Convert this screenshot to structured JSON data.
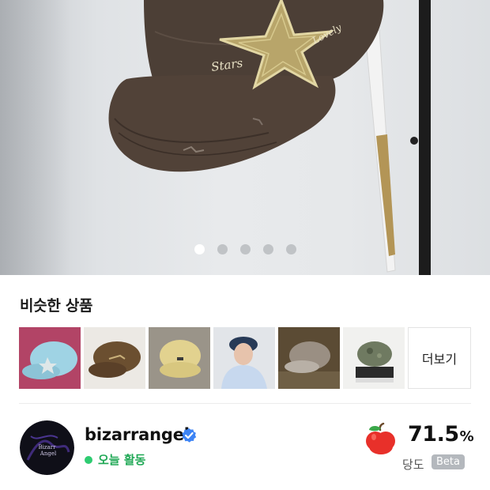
{
  "hero": {
    "image_name": "product-photo-brown-cap-star-patch",
    "cap_text_left": "Stars",
    "cap_text_right": "Lovely",
    "carousel": {
      "total": 5,
      "active": 0
    }
  },
  "similar": {
    "title": "비슷한 상품",
    "more_label": "더보기",
    "items": [
      {
        "name": "light-blue-cap-star-patch"
      },
      {
        "name": "brown-cap-embroidered"
      },
      {
        "name": "yellow-cap-small-logo"
      },
      {
        "name": "navy-cap-worn-by-model"
      },
      {
        "name": "grey-cap-on-knit"
      },
      {
        "name": "olive-camo-cap"
      }
    ]
  },
  "seller": {
    "name": "bizarrangel",
    "avatar_text": "Bizarr Angel",
    "verified_icon": "verified-check-icon",
    "activity": "오늘 활동",
    "score_value": "71.5",
    "score_unit": "%",
    "score_label": "당도",
    "beta_label": "Beta",
    "score_icon": "apple-icon"
  },
  "colors": {
    "activity_green": "#2ecc71",
    "activity_text": "#1fa855",
    "verified_blue": "#3d84f5",
    "apple_red": "#e8302a",
    "beta_grey": "#b4b8bd"
  }
}
